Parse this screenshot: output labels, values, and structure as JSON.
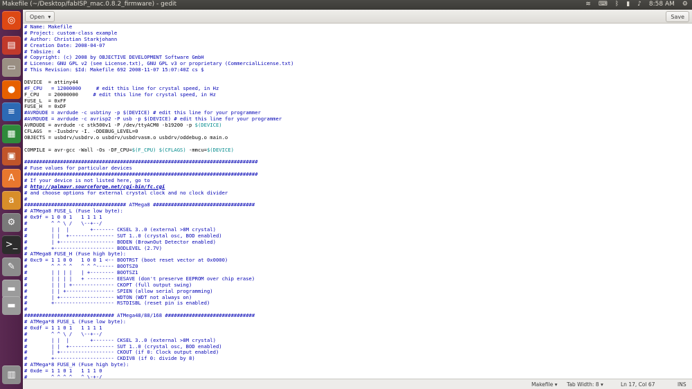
{
  "window": {
    "title": "Makefile (~/Desktop/fabISP_mac.0.8.2_firmware) - gedit",
    "time": "8:58 AM"
  },
  "toolbar": {
    "open_label": "Open",
    "save_label": "Save"
  },
  "launcher": {
    "items": [
      {
        "name": "dash-home-icon",
        "glyph": "◎",
        "color": "#dd4814"
      },
      {
        "name": "file-manager-icon",
        "glyph": "▤",
        "color": "#c0392b"
      },
      {
        "name": "files-icon",
        "glyph": "▭",
        "color": "#9a8f83"
      },
      {
        "name": "firefox-icon",
        "glyph": "●",
        "color": "#e66000"
      },
      {
        "name": "libreoffice-writer-icon",
        "glyph": "≡",
        "color": "#2d6ab4"
      },
      {
        "name": "libreoffice-calc-icon",
        "glyph": "▦",
        "color": "#2f8a3b"
      },
      {
        "name": "libreoffice-impress-icon",
        "glyph": "▣",
        "color": "#c0542a"
      },
      {
        "name": "software-center-icon",
        "glyph": "A",
        "color": "#e8772e"
      },
      {
        "name": "amazon-icon",
        "glyph": "a",
        "color": "#d88e2a"
      },
      {
        "name": "system-settings-icon",
        "glyph": "⚙",
        "color": "#7a7a7a"
      },
      {
        "name": "terminal-icon",
        "glyph": ">_",
        "color": "#2c2c2c"
      },
      {
        "name": "text-editor-icon",
        "glyph": "✎",
        "color": "#8c8c8c"
      },
      {
        "name": "drive-icon",
        "glyph": "▬",
        "color": "#9b9b9b"
      },
      {
        "name": "drive-icon",
        "glyph": "▬",
        "color": "#9b9b9b"
      },
      {
        "name": "trash-icon",
        "glyph": "▥",
        "color": "#8d8d8d"
      }
    ]
  },
  "status": {
    "language": "Makefile",
    "tab_width": "Tab Width: 8",
    "position": "Ln 17, Col 67",
    "mode": "INS"
  },
  "lines": [
    {
      "t": "# Name: Makefile",
      "s": "comment"
    },
    {
      "t": "# Project: custom-class example",
      "s": "comment"
    },
    {
      "t": "# Author: Christian Starkjohann",
      "s": "comment"
    },
    {
      "t": "# Creation Date: 2008-04-07",
      "s": "comment"
    },
    {
      "t": "# Tabsize: 4",
      "s": "comment"
    },
    {
      "t": "# Copyright: (c) 2008 by OBJECTIVE DEVELOPMENT Software GmbH",
      "s": "comment"
    },
    {
      "t": "# License: GNU GPL v2 (see License.txt), GNU GPL v3 or proprietary (CommercialLicense.txt)",
      "s": "comment"
    },
    {
      "t": "# This Revision: $Id: Makefile 692 2008-11-07 15:07:40Z cs $",
      "s": "comment"
    },
    {
      "t": "",
      "s": "plain"
    },
    {
      "t": "DEVICE  = attiny44",
      "s": "plain"
    },
    {
      "t": "#F_CPU   = 12000000     # edit this line for crystal speed, in Hz",
      "s": "comment"
    },
    {
      "t": "F_CPU   = 20000000     # edit this line for crystal speed, in Hz",
      "s": "plain"
    },
    {
      "t": "FUSE_L  = 0xFF",
      "s": "plain"
    },
    {
      "t": "FUSE_H  = 0xDF",
      "s": "plain"
    },
    {
      "t": "#AVRDUDE = avrdude -c usbtiny -p $(DEVICE) # edit this line for your programmer",
      "s": "comment"
    },
    {
      "t": "#AVRDUDE = avrdude -c avrisp2 -P usb -p $(DEVICE) # edit this line for your programmer",
      "s": "comment"
    },
    {
      "t": "AVRDUDE = avrdude -c stk500v1 -P /dev/ttyACM0 -b19200 -p $(DEVICE)",
      "s": "plain"
    },
    {
      "t": "CFLAGS  = -Iusbdrv -I. -DDEBUG_LEVEL=0",
      "s": "plain"
    },
    {
      "t": "OBJECTS = usbdrv/usbdrv.o usbdrv/usbdrvasm.o usbdrv/oddebug.o main.o",
      "s": "plain"
    },
    {
      "t": "",
      "s": "plain"
    },
    {
      "t": "COMPILE = avr-gcc -Wall -Os -DF_CPU=$(F_CPU) $(CFLAGS) -mmcu=$(DEVICE)",
      "s": "plain"
    },
    {
      "t": "",
      "s": "plain"
    },
    {
      "t": "##############################################################################",
      "s": "comment"
    },
    {
      "t": "# Fuse values for particular devices",
      "s": "comment"
    },
    {
      "t": "##############################################################################",
      "s": "comment"
    },
    {
      "t": "# If your device is not listed here, go to",
      "s": "comment"
    },
    {
      "t": "# http://palmavr.sourceforge.net/cgi-bin/fc.cgi",
      "s": "url"
    },
    {
      "t": "# and choose options for external crystal clock and no clock divider",
      "s": "comment"
    },
    {
      "t": "#",
      "s": "comment"
    },
    {
      "t": "################################## ATMega8 ##################################",
      "s": "comment"
    },
    {
      "t": "# ATMega8 FUSE_L (Fuse low byte):",
      "s": "comment"
    },
    {
      "t": "# 0x9f = 1 0 0 1   1 1 1 1",
      "s": "comment"
    },
    {
      "t": "#        ^ ^ \\ /   \\--+--/",
      "s": "comment"
    },
    {
      "t": "#        | |  |       +------- CKSEL 3..0 (external >8M crystal)",
      "s": "comment"
    },
    {
      "t": "#        | |  +--------------- SUT 1..0 (crystal osc, BOD enabled)",
      "s": "comment"
    },
    {
      "t": "#        | +------------------ BODEN (BrownOut Detector enabled)",
      "s": "comment"
    },
    {
      "t": "#        +-------------------- BODLEVEL (2.7V)",
      "s": "comment"
    },
    {
      "t": "# ATMega8 FUSE_H (Fuse high byte):",
      "s": "comment"
    },
    {
      "t": "# 0xc9 = 1 1 0 0   1 0 0 1 <-- BOOTRST (boot reset vector at 0x0000)",
      "s": "comment"
    },
    {
      "t": "#        ^ ^ ^ ^   ^ ^ ^------ BOOTSZ0",
      "s": "comment"
    },
    {
      "t": "#        | | | |   | +-------- BOOTSZ1",
      "s": "comment"
    },
    {
      "t": "#        | | | |   + --------- EESAVE (don't preserve EEPROM over chip erase)",
      "s": "comment"
    },
    {
      "t": "#        | | | +-------------- CKOPT (full output swing)",
      "s": "comment"
    },
    {
      "t": "#        | | +---------------- SPIEN (allow serial programming)",
      "s": "comment"
    },
    {
      "t": "#        | +------------------ WDTON (WDT not always on)",
      "s": "comment"
    },
    {
      "t": "#        +-------------------- RSTDISBL (reset pin is enabled)",
      "s": "comment"
    },
    {
      "t": "#",
      "s": "comment"
    },
    {
      "t": "############################## ATMega48/88/168 ##############################",
      "s": "comment"
    },
    {
      "t": "# ATMega*8 FUSE_L (Fuse low byte):",
      "s": "comment"
    },
    {
      "t": "# 0xdf = 1 1 0 1   1 1 1 1",
      "s": "comment"
    },
    {
      "t": "#        ^ ^ \\ /   \\--+--/",
      "s": "comment"
    },
    {
      "t": "#        | |  |       +------- CKSEL 3..0 (external >8M crystal)",
      "s": "comment"
    },
    {
      "t": "#        | |  +--------------- SUT 1..0 (crystal osc, BOD enabled)",
      "s": "comment"
    },
    {
      "t": "#        | +------------------ CKOUT (if 0: Clock output enabled)",
      "s": "comment"
    },
    {
      "t": "#        +-------------------- CKDIV8 (if 0: divide by 8)",
      "s": "comment"
    },
    {
      "t": "# ATMega*8 FUSE_H (Fuse high byte):",
      "s": "comment"
    },
    {
      "t": "# 0xde = 1 1 0 1   1 1 1 0",
      "s": "comment"
    },
    {
      "t": "#        ^ ^ ^ ^   ^ \\-+-/",
      "s": "comment"
    }
  ]
}
